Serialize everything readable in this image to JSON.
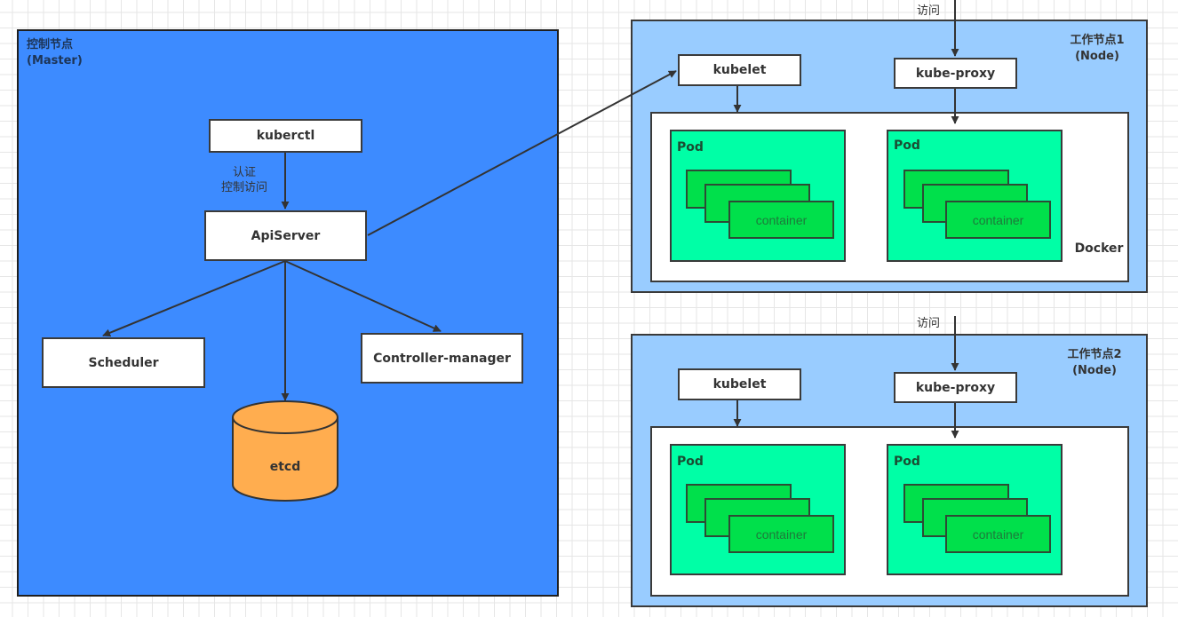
{
  "master": {
    "title_line1": "控制节点",
    "title_line2": "(Master)",
    "kuberctl": "kuberctl",
    "auth_line1": "认证",
    "auth_line2": "控制访问",
    "apiserver": "ApiServer",
    "scheduler": "Scheduler",
    "controller_manager": "Controller-manager",
    "etcd": "etcd",
    "colors": {
      "background": "#3d8bff",
      "etcd": "#ffad4f"
    }
  },
  "workers": [
    {
      "title_line1": "工作节点1",
      "title_line2": "(Node)",
      "access_label": "访问",
      "kubelet": "kubelet",
      "kube_proxy": "kube-proxy",
      "runtime_label": "Docker",
      "pods": [
        {
          "label": "Pod",
          "container_label": "container"
        },
        {
          "label": "Pod",
          "container_label": "container"
        }
      ]
    },
    {
      "title_line1": "工作节点2",
      "title_line2": "(Node)",
      "access_label": "访问",
      "kubelet": "kubelet",
      "kube_proxy": "kube-proxy",
      "runtime_label": "",
      "pods": [
        {
          "label": "Pod",
          "container_label": "container"
        },
        {
          "label": "Pod",
          "container_label": "container"
        }
      ]
    }
  ],
  "colors": {
    "worker_bg": "#99ccff",
    "pod_bg": "#00ffa6",
    "container_bg": "#00e04b",
    "arrow": "#333333"
  }
}
